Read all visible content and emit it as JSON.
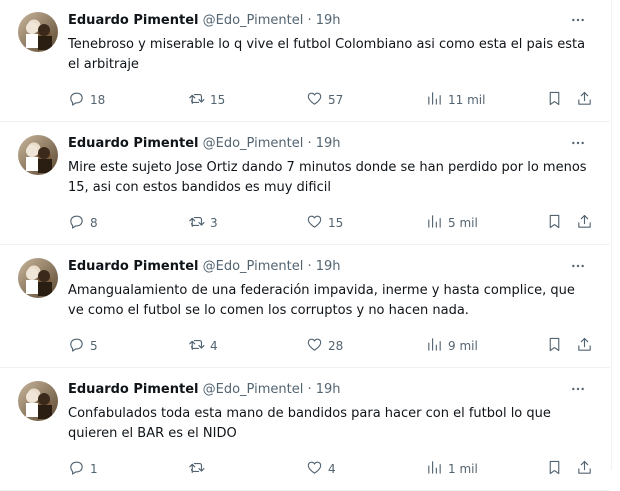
{
  "tweets": [
    {
      "name": "Eduardo Pimentel",
      "handle": "@Edo_Pimentel",
      "separator": "·",
      "time": "19h",
      "text": "Tenebroso y miserable  lo q vive el futbol Colombiano asi como esta el pais esta el arbitraje",
      "replies": "18",
      "retweets": "15",
      "likes": "57",
      "views": "11 mil"
    },
    {
      "name": "Eduardo Pimentel",
      "handle": "@Edo_Pimentel",
      "separator": "·",
      "time": "19h",
      "text": "Mire este sujeto Jose Ortiz dando 7 minutos donde se han  perdido por lo menos 15, asi con estos bandidos es muy dificil",
      "replies": "8",
      "retweets": "3",
      "likes": "15",
      "views": "5 mil"
    },
    {
      "name": "Eduardo Pimentel",
      "handle": "@Edo_Pimentel",
      "separator": "·",
      "time": "19h",
      "text": "Amangualamiento de una federación impavida, inerme y hasta complice, que ve como  el futbol se lo comen los corruptos y no hacen nada.",
      "replies": "5",
      "retweets": "4",
      "likes": "28",
      "views": "9 mil"
    },
    {
      "name": "Eduardo Pimentel",
      "handle": "@Edo_Pimentel",
      "separator": "·",
      "time": "19h",
      "text": "Confabulados toda esta mano de bandidos para hacer con el futbol lo que quieren el BAR es el NIDO",
      "replies": "1",
      "retweets": "",
      "likes": "4",
      "views": "1 mil"
    }
  ],
  "icons": {
    "reply": "reply-icon",
    "retweet": "retweet-icon",
    "like": "heart-icon",
    "views": "views-icon",
    "bookmark": "bookmark-icon",
    "share": "share-icon",
    "more": "more-icon"
  },
  "colors": {
    "text": "#0f1419",
    "muted": "#536471",
    "border": "#eff3f4"
  }
}
